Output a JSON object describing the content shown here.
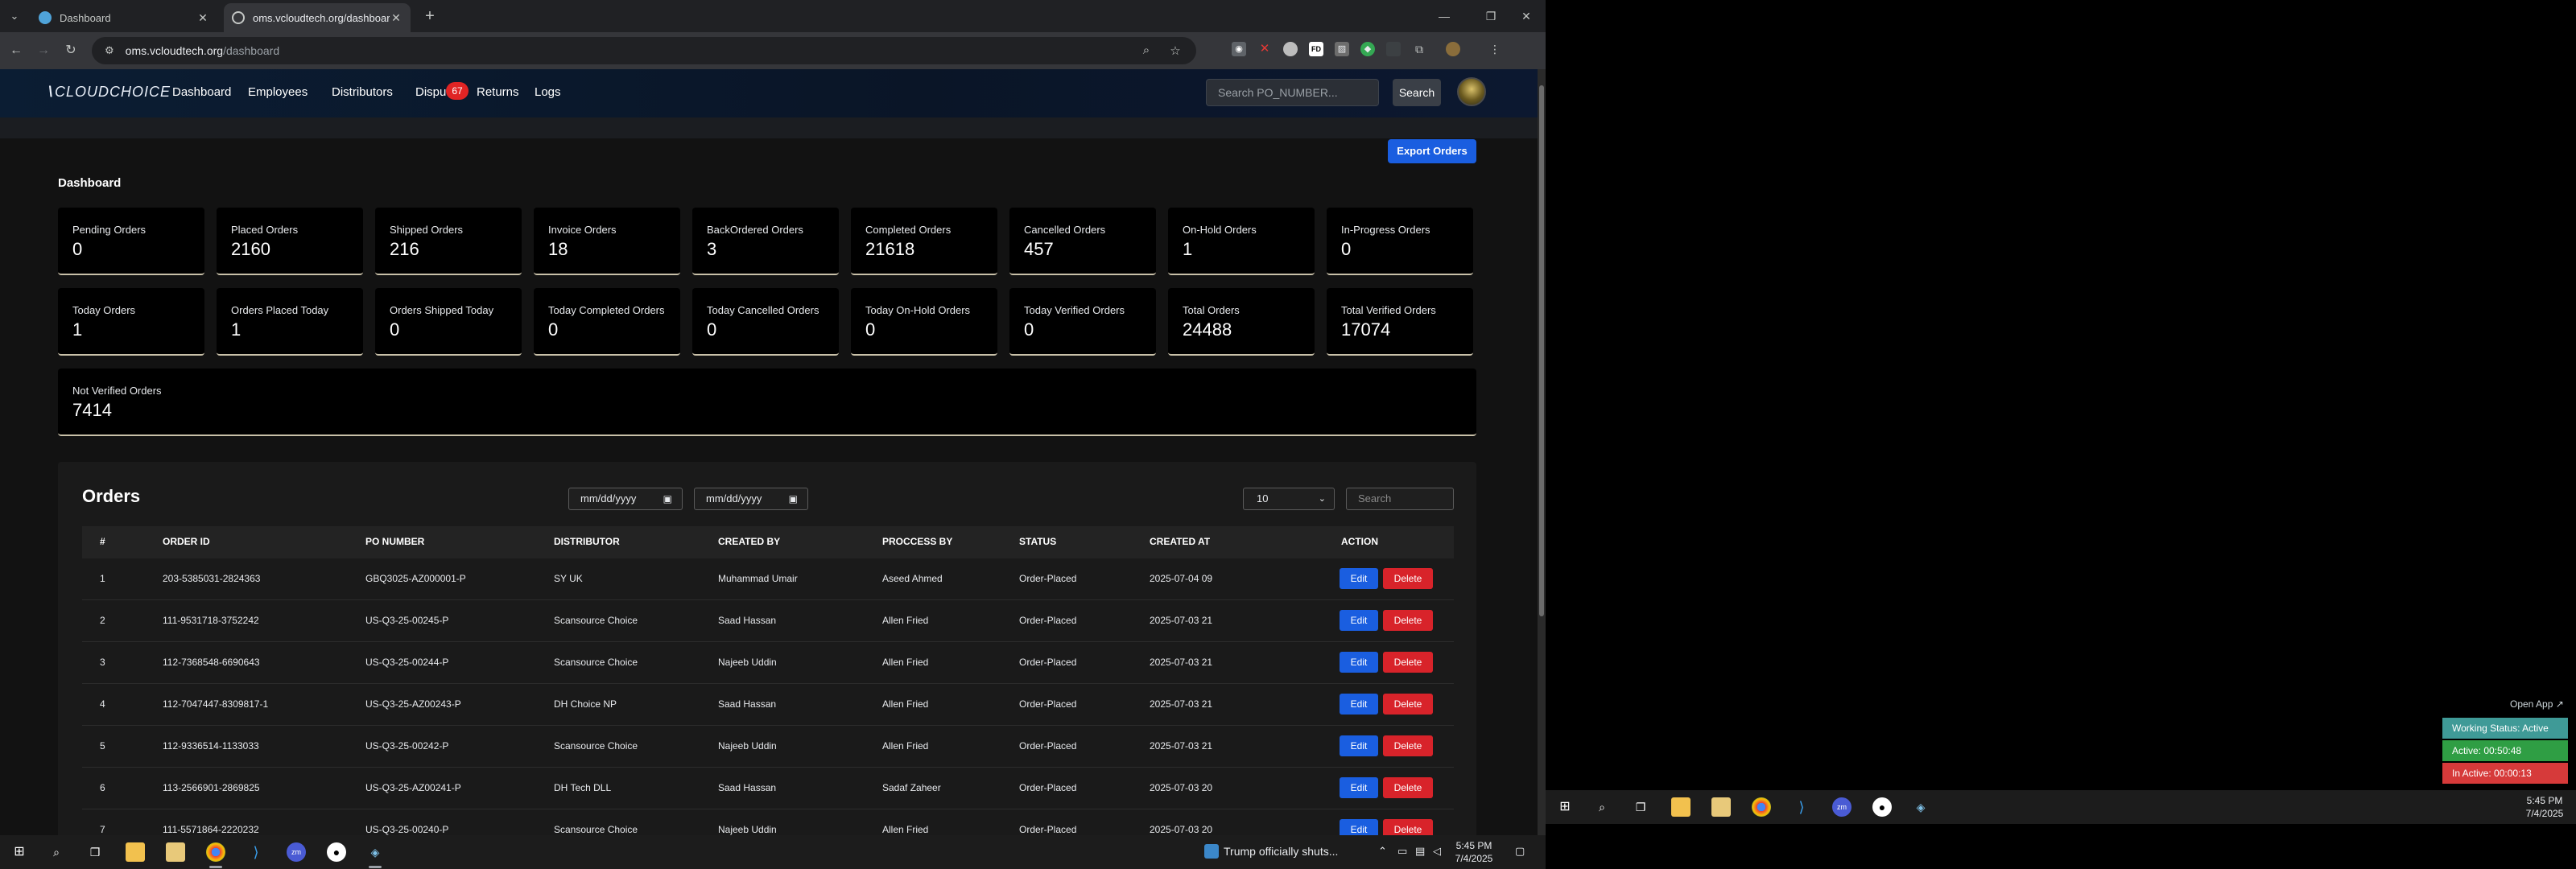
{
  "browser": {
    "tabs": [
      {
        "title": "Dashboard"
      },
      {
        "title": "oms.vcloudtech.org/dashboard"
      }
    ],
    "url_host": "oms.vcloudtech.org",
    "url_path": "/dashboard"
  },
  "app": {
    "logo": "CLOUDCHOICE",
    "nav": [
      "Dashboard",
      "Employees",
      "Distributors",
      "Dispu",
      "Returns",
      "Logs"
    ],
    "disputes_badge": "67",
    "po_search_placeholder": "Search PO_NUMBER...",
    "search_button": "Search",
    "export_button": "Export Orders",
    "dashboard_title": "Dashboard"
  },
  "stats": [
    {
      "label": "Pending Orders",
      "value": "0"
    },
    {
      "label": "Placed Orders",
      "value": "2160"
    },
    {
      "label": "Shipped Orders",
      "value": "216"
    },
    {
      "label": "Invoice Orders",
      "value": "18"
    },
    {
      "label": "BackOrdered Orders",
      "value": "3"
    },
    {
      "label": "Completed Orders",
      "value": "21618"
    },
    {
      "label": "Cancelled Orders",
      "value": "457"
    },
    {
      "label": "On-Hold Orders",
      "value": "1"
    },
    {
      "label": "In-Progress Orders",
      "value": "0"
    },
    {
      "label": "Today Orders",
      "value": "1"
    },
    {
      "label": "Orders Placed Today",
      "value": "1"
    },
    {
      "label": "Orders Shipped Today",
      "value": "0"
    },
    {
      "label": "Today Completed Orders",
      "value": "0"
    },
    {
      "label": "Today Cancelled Orders",
      "value": "0"
    },
    {
      "label": "Today On-Hold Orders",
      "value": "0"
    },
    {
      "label": "Today Verified Orders",
      "value": "0"
    },
    {
      "label": "Total Orders",
      "value": "24488"
    },
    {
      "label": "Total Verified Orders",
      "value": "17074"
    },
    {
      "label": "Not Verified Orders",
      "value": "7414"
    }
  ],
  "orders": {
    "title": "Orders",
    "date_from": "mm/dd/yyyy",
    "date_to": "mm/dd/yyyy",
    "page_size": "10",
    "search_placeholder": "Search",
    "columns": [
      "#",
      "ORDER ID",
      "PO NUMBER",
      "DISTRIBUTOR",
      "CREATED BY",
      "PROCCESS BY",
      "STATUS",
      "CREATED AT",
      "ACTION"
    ],
    "edit_label": "Edit",
    "delete_label": "Delete",
    "rows": [
      [
        "1",
        "203-5385031-2824363",
        "GBQ3025-AZ000001-P",
        "SY UK",
        "Muhammad Umair",
        "Aseed Ahmed",
        "Order-Placed",
        "2025-07-04 09"
      ],
      [
        "2",
        "111-9531718-3752242",
        "US-Q3-25-00245-P",
        "Scansource Choice",
        "Saad Hassan",
        "Allen Fried",
        "Order-Placed",
        "2025-07-03 21"
      ],
      [
        "3",
        "112-7368548-6690643",
        "US-Q3-25-00244-P",
        "Scansource Choice",
        "Najeeb Uddin",
        "Allen Fried",
        "Order-Placed",
        "2025-07-03 21"
      ],
      [
        "4",
        "112-7047447-8309817-1",
        "US-Q3-25-AZ00243-P",
        "DH Choice NP",
        "Saad Hassan",
        "Allen Fried",
        "Order-Placed",
        "2025-07-03 21"
      ],
      [
        "5",
        "112-9336514-1133033",
        "US-Q3-25-00242-P",
        "Scansource Choice",
        "Najeeb Uddin",
        "Allen Fried",
        "Order-Placed",
        "2025-07-03 21"
      ],
      [
        "6",
        "113-2566901-2869825",
        "US-Q3-25-AZ00241-P",
        "DH Tech DLL",
        "Saad Hassan",
        "Sadaf Zaheer",
        "Order-Placed",
        "2025-07-03 20"
      ],
      [
        "7",
        "111-5571864-2220232",
        "US-Q3-25-00240-P",
        "Scansource Choice",
        "Najeeb Uddin",
        "Allen Fried",
        "Order-Placed",
        "2025-07-03 20"
      ]
    ]
  },
  "taskbar": {
    "news": "Trump officially shuts...",
    "time": "5:45 PM",
    "date": "7/4/2025"
  },
  "tracker": {
    "open_app": "Open App ↗",
    "working_status": "Working Status: Active",
    "active": "Active: 00:50:48",
    "inactive": "In Active: 00:00:13",
    "colors": {
      "status": "#3f9a97",
      "active": "#2f9e44",
      "inactive": "#d63a3a"
    }
  }
}
